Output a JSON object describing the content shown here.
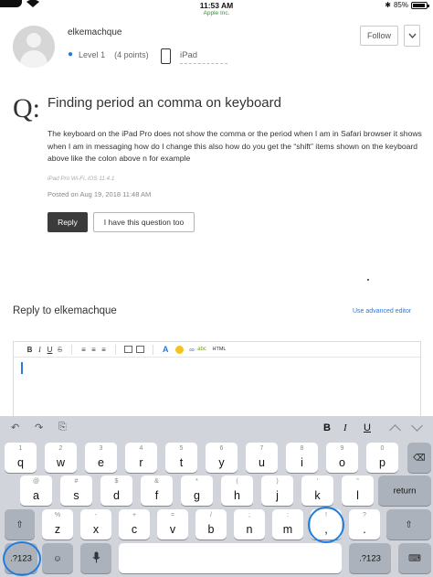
{
  "status_bar": {
    "time": "11:53 AM",
    "carrier": "Apple Inc.",
    "battery": "85%",
    "bluetooth_icon": "bluetooth-icon"
  },
  "profile": {
    "username": "elkemachque",
    "level": "Level 1",
    "points": "(4 points)",
    "device": "iPad",
    "follow_label": "Follow"
  },
  "question": {
    "mark": "Q:",
    "title": "Finding period an comma on keyboard",
    "body": "The keyboard on the iPad Pro does not show the comma or the period when I am in Safari browser it shows when I am in messaging how do I change this also how do you get the “shift” items shown on the keyboard above like the colon above n for example",
    "device_info": "iPad Pro Wi-Fi, iOS 11.4.1",
    "posted": "Posted on Aug 19, 2018 11:48 AM",
    "reply_label": "Reply",
    "same_label": "I have this question too"
  },
  "reply_editor": {
    "heading": "Reply to elkemachque",
    "advanced_link": "Use advanced editor",
    "toolbar": {
      "bold": "B",
      "italic": "I",
      "underline": "U",
      "strike": "S",
      "html": "HTML"
    }
  },
  "keyboard": {
    "format": {
      "bold": "B",
      "italic": "I",
      "underline": "U"
    },
    "row1": [
      {
        "pri": "q",
        "sec": "1"
      },
      {
        "pri": "w",
        "sec": "2"
      },
      {
        "pri": "e",
        "sec": "3"
      },
      {
        "pri": "r",
        "sec": "4"
      },
      {
        "pri": "t",
        "sec": "5"
      },
      {
        "pri": "y",
        "sec": "6"
      },
      {
        "pri": "u",
        "sec": "7"
      },
      {
        "pri": "i",
        "sec": "8"
      },
      {
        "pri": "o",
        "sec": "9"
      },
      {
        "pri": "p",
        "sec": "0"
      }
    ],
    "row2": [
      {
        "pri": "a",
        "sec": "@"
      },
      {
        "pri": "s",
        "sec": "#"
      },
      {
        "pri": "d",
        "sec": "$"
      },
      {
        "pri": "f",
        "sec": "&"
      },
      {
        "pri": "g",
        "sec": "*"
      },
      {
        "pri": "h",
        "sec": "("
      },
      {
        "pri": "j",
        "sec": ")"
      },
      {
        "pri": "k",
        "sec": "'"
      },
      {
        "pri": "l",
        "sec": "\""
      }
    ],
    "row3": [
      {
        "pri": "z",
        "sec": "%"
      },
      {
        "pri": "x",
        "sec": "-"
      },
      {
        "pri": "c",
        "sec": "+"
      },
      {
        "pri": "v",
        "sec": "="
      },
      {
        "pri": "b",
        "sec": "/"
      },
      {
        "pri": "n",
        "sec": ";"
      },
      {
        "pri": "m",
        "sec": ":"
      },
      {
        "pri": ",",
        "sec": "!"
      },
      {
        "pri": ".",
        "sec": "?"
      }
    ],
    "delete_label": "⌫",
    "return_label": "return",
    "shift_label": "⇧",
    "numbers_label": ".?123",
    "emoji_label": "☺",
    "dictation_label": "mic",
    "hide_label": "⌨",
    "undo_icon": "↶",
    "redo_icon": "↷",
    "paste_icon": "⎘"
  },
  "colors": {
    "accent": "#2a7ad9",
    "annotation": "#1f7dde",
    "carrier_green": "#2a9a2a"
  }
}
